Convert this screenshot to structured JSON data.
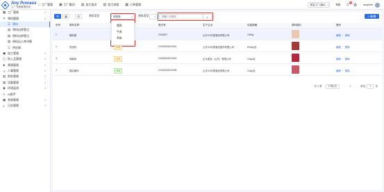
{
  "header": {
    "logo_title": "Any Process",
    "logo_sub": "工厂流程管理系统",
    "nav": [
      {
        "label": "工厂管理",
        "icon": "factory-icon"
      },
      {
        "label": "工厂概况",
        "icon": "home-icon"
      },
      {
        "label": "加工批次",
        "icon": "batch-icon"
      },
      {
        "label": "加工流程",
        "icon": "flow-icon"
      },
      {
        "label": "订单管理",
        "icon": "order-icon"
      }
    ],
    "org_select": "鲁加工厂(演示...",
    "link_text": "帮助",
    "notification_count": "3",
    "username": "anyfarm"
  },
  "sidebar": {
    "items": [
      {
        "label": "工厂管理",
        "icon": "factory-icon",
        "expandable": true
      },
      {
        "label": "原料管理",
        "icon": "tools-icon",
        "expandable": true
      },
      {
        "label": "原料",
        "icon": "list-icon",
        "sub": true,
        "active": true
      },
      {
        "label": "原料出库登记",
        "icon": "doc-icon",
        "sub": true
      },
      {
        "label": "原料出库登记",
        "icon": "doc-icon",
        "sub": true
      },
      {
        "label": "原料出入库详情",
        "icon": "doc-icon",
        "sub": true
      },
      {
        "label": "供应商",
        "icon": "supplier-icon",
        "sub": true
      },
      {
        "label": "加工管理",
        "icon": "process-icon",
        "expandable": true
      },
      {
        "label": "投入品管理",
        "icon": "box-icon",
        "expandable": true
      },
      {
        "label": "溯源管理",
        "icon": "trace-icon",
        "expandable": true
      },
      {
        "label": "人事管理",
        "icon": "user-icon",
        "expandable": true
      },
      {
        "label": "财务管理",
        "icon": "finance-icon",
        "expandable": true
      },
      {
        "label": "设备管理",
        "icon": "device-icon",
        "expandable": true
      },
      {
        "label": "环境监测",
        "icon": "env-icon",
        "expandable": true
      },
      {
        "label": "AI助手",
        "icon": "ai-icon",
        "expandable": false
      },
      {
        "label": "系统管理",
        "icon": "system-icon",
        "expandable": true
      },
      {
        "label": "日志管理",
        "icon": "log-icon",
        "expandable": true
      }
    ]
  },
  "toolbar": {
    "btn_primary": "列表",
    "btn_view": "卡片",
    "btn_icon": "⊞",
    "filter1_label": "原料类型",
    "filter2_label": "原料类型",
    "filter2_value": "",
    "search_placeholder": "请输入关键字",
    "add_label": "+ 新增"
  },
  "dropdown": {
    "options": [
      "猪肉",
      "牛肉",
      "鸡肉"
    ]
  },
  "table": {
    "columns": [
      "序号",
      "原料名称",
      "原料类型",
      "登记号",
      "生产企业",
      "包装规格",
      "原料图片",
      "操作"
    ],
    "rows": [
      {
        "no": "1",
        "name": "猪前腿",
        "type": "鲜",
        "reg": "2026667",
        "company": "山东XX肉类食品有限公司",
        "spec": "160kg",
        "img_color": "#e8c9b3"
      },
      {
        "no": "2",
        "name": "肉馅料",
        "type": "冷冻",
        "reg": "20260508020081",
        "company": "山东XX肉类食品股份有限公司",
        "spec": "500kg/包",
        "img_color": "#a33a3a"
      },
      {
        "no": "3",
        "name": "鸡胸肉",
        "type": "冷冻",
        "reg": "20260508020083",
        "company": "正大食品（山东）有限公司",
        "spec": "10kg/包",
        "img_color": "#b02b40"
      },
      {
        "no": "4",
        "name": "猪后腿肉",
        "type": "冷冻",
        "reg": "20260508020085",
        "company": "山东XX肉类食品有限公司",
        "spec": "10kg/包",
        "img_color": "#c45b6a"
      }
    ],
    "action_edit": "编辑",
    "action_delete": "删除"
  },
  "pagination": {
    "total": "共 4 条",
    "page_size": "10条/页",
    "current": "1",
    "goto_label": "前往",
    "goto_value": "1",
    "page_suffix": "页"
  },
  "colors": {
    "primary": "#2f6fe0",
    "highlight": "#e03c3c"
  }
}
